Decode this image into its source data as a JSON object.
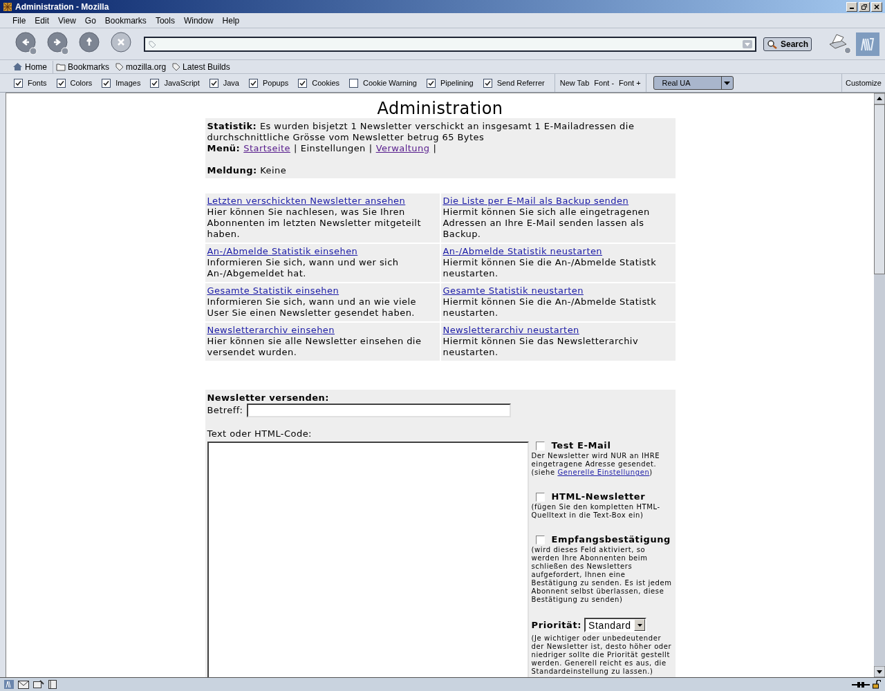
{
  "window": {
    "title": "Administration - Mozilla"
  },
  "menu_bar": [
    "File",
    "Edit",
    "View",
    "Go",
    "Bookmarks",
    "Tools",
    "Window",
    "Help"
  ],
  "navigation": {
    "search_button": "Search"
  },
  "personal_toolbar": [
    {
      "kind": "home",
      "label": "Home"
    },
    {
      "kind": "folder",
      "label": "Bookmarks"
    },
    {
      "kind": "bookmark",
      "label": "mozilla.org"
    },
    {
      "kind": "bookmark",
      "label": "Latest Builds"
    }
  ],
  "prefbar": {
    "checkboxes": [
      {
        "label": "Fonts",
        "checked": true
      },
      {
        "label": "Colors",
        "checked": true
      },
      {
        "label": "Images",
        "checked": true
      },
      {
        "label": "JavaScript",
        "checked": true
      },
      {
        "label": "Java",
        "checked": true
      },
      {
        "label": "Popups",
        "checked": true
      },
      {
        "label": "Cookies",
        "checked": true
      },
      {
        "label": "Cookie Warning",
        "checked": false
      },
      {
        "label": "Pipelining",
        "checked": true
      },
      {
        "label": "Send Referrer",
        "checked": true
      }
    ],
    "buttons": [
      "New Tab",
      "Font -",
      "Font +"
    ],
    "user_agent_select": "Real UA",
    "customize": "Customize"
  },
  "page": {
    "heading": "Administration",
    "statistics": {
      "label": "Statistik:",
      "text": "Es wurden bisjetzt 1 Newsletter verschickt an insgesamt 1 E-Mailadressen die durchschnittliche Grösse vom Newsletter betrug 65 Bytes"
    },
    "menu": {
      "label": "Menü:",
      "items": [
        {
          "kind": "visited_link",
          "text": "Startseite"
        },
        {
          "kind": "separator",
          "text": "|"
        },
        {
          "kind": "text",
          "text": "Einstellungen"
        },
        {
          "kind": "separator",
          "text": "|"
        },
        {
          "kind": "visited_link",
          "text": "Verwaltung"
        },
        {
          "kind": "separator",
          "text": "|"
        }
      ]
    },
    "message": {
      "label": "Meldung:",
      "text": "Keine"
    },
    "actions": [
      [
        {
          "link": "Letzten verschickten Newsletter ansehen",
          "description": "Hier können Sie nachlesen, was Sie Ihren Abonnenten im letzten Newsletter mitgeteilt haben."
        },
        {
          "link": "Die Liste per E-Mail als Backup senden",
          "description": "Hiermit können Sie sich alle eingetragenen Adressen an Ihre E-Mail senden lassen als Backup."
        }
      ],
      [
        {
          "link": "An-/Abmelde Statistik einsehen",
          "description": "Informieren Sie sich, wann und wer sich An-/Abgemeldet hat."
        },
        {
          "link": "An-/Abmelde Statistik neustarten",
          "description": "Hiermit können Sie die An-/Abmelde Statistk neustarten."
        }
      ],
      [
        {
          "link": "Gesamte Statistik einsehen",
          "description": "Informieren Sie sich, wann und an wie viele User Sie einen Newsletter gesendet haben."
        },
        {
          "link": "Gesamte Statistik neustarten",
          "description": "Hiermit können Sie die An-/Abmelde Statistk neustarten."
        }
      ],
      [
        {
          "link": "Newsletterarchiv einsehen",
          "description": "Hier können sie alle Newsletter einsehen die versendet wurden."
        },
        {
          "link": "Newsletterarchiv neustarten",
          "description": "Hiermit können Sie das Newsletterarchiv neustarten."
        }
      ]
    ],
    "newsletter": {
      "heading": "Newsletter versenden:",
      "subject_label": "Betreff:",
      "body_label": "Text oder HTML-Code:",
      "options": [
        {
          "title": "Test E-Mail",
          "checked": false,
          "description": "Der Newsletter wird NUR an IHRE eingetragene Adresse gesendet. (siehe ",
          "link": "Generelle Einstellungen",
          "description_end": ")"
        },
        {
          "title": "HTML-Newsletter",
          "checked": false,
          "description": "(fügen Sie den kompletten HTML-Quelltext in die Text-Box ein)"
        },
        {
          "title": "Empfangsbestätigung",
          "checked": false,
          "description": "(wird dieses Feld aktiviert, so werden Ihre Abonnenten beim schließen des Newsletters aufgefordert, Ihnen eine Bestätigung zu senden. Es ist jedem Abonnent selbst überlassen, diese Bestätigung zu senden)"
        }
      ],
      "priority": {
        "label": "Priorität:",
        "value": "Standard",
        "description": "(Je wichtiger oder unbedeutender der Newsletter ist, desto höher oder niedriger sollte die Priorität gestellt werden. Generell reicht es aus, die Standardeinstellung zu lassen.)"
      }
    }
  }
}
